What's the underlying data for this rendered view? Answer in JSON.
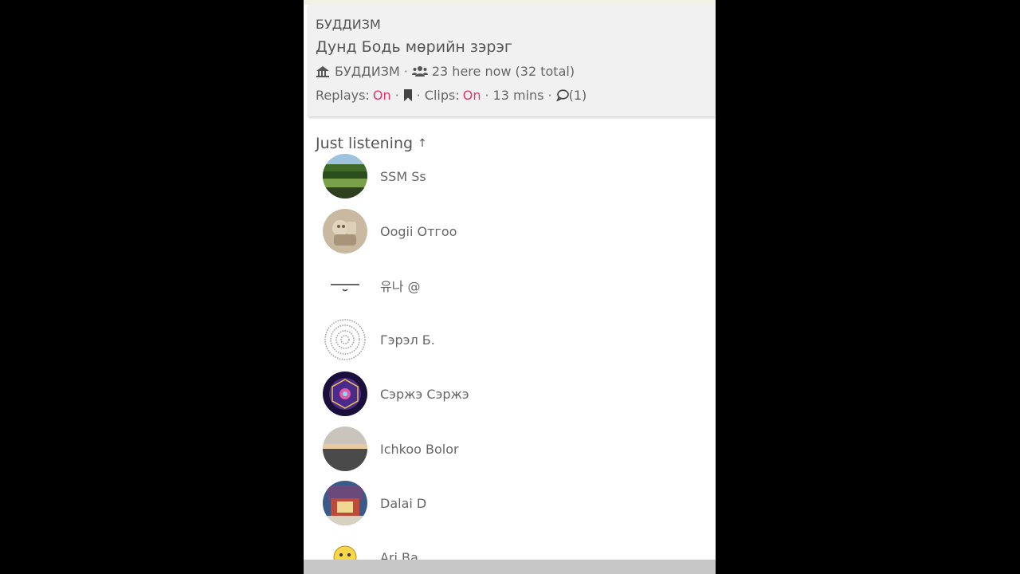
{
  "header": {
    "section": "БУДДИЗМ",
    "title": "Дунд Бодь мөрийн зэрэг",
    "club_icon": "club-house-icon",
    "club_name": "БУДДИЗМ",
    "people_icon": "people-icon",
    "listeners": "23 here now (32 total)",
    "replays_label": "Replays:",
    "replays_value": "On",
    "bookmark_icon": "bookmark-icon",
    "clips_label": "Clips:",
    "clips_value": "On",
    "duration": "13 mins",
    "chat_icon": "chat-bubble-icon",
    "chat_count": "(1)",
    "separator": "·",
    "accent_color": "#e0366d"
  },
  "section_title": "Just listening",
  "section_arrow": "↑",
  "listeners": [
    {
      "name": "SSM Ss",
      "avatar": "park-landscape"
    },
    {
      "name": "Oogii Отгоо",
      "avatar": "stone-carving"
    },
    {
      "name": "유나 @",
      "avatar": "text-logo"
    },
    {
      "name": "Гэрэл Б.",
      "avatar": "spiral-text"
    },
    {
      "name": "Сэржэ Сэржэ",
      "avatar": "sacred-geometry"
    },
    {
      "name": "Ichkoo Bolor",
      "avatar": "beach-sunset"
    },
    {
      "name": "Dalai D",
      "avatar": "temple-interior"
    },
    {
      "name": "Ari Ba",
      "avatar": "emoji-face"
    }
  ]
}
